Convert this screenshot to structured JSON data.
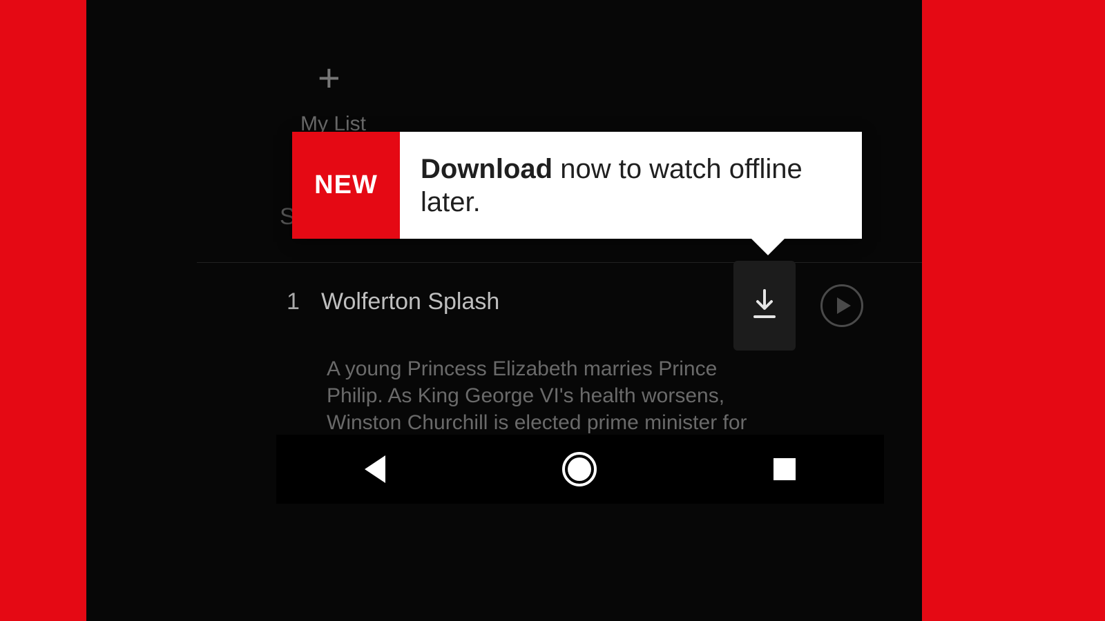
{
  "mylist": {
    "label": "My List"
  },
  "partial_letter": "S",
  "tooltip": {
    "badge": "NEW",
    "bold": "Download",
    "rest": " now to watch offline later."
  },
  "episode": {
    "number": "1",
    "title": "Wolferton Splash",
    "description": "A young Princess Elizabeth marries Prince Philip. As King George VI's health worsens, Winston Churchill is elected prime minister for the second"
  },
  "colors": {
    "brand_red": "#e50914",
    "bg_black": "#070707"
  }
}
